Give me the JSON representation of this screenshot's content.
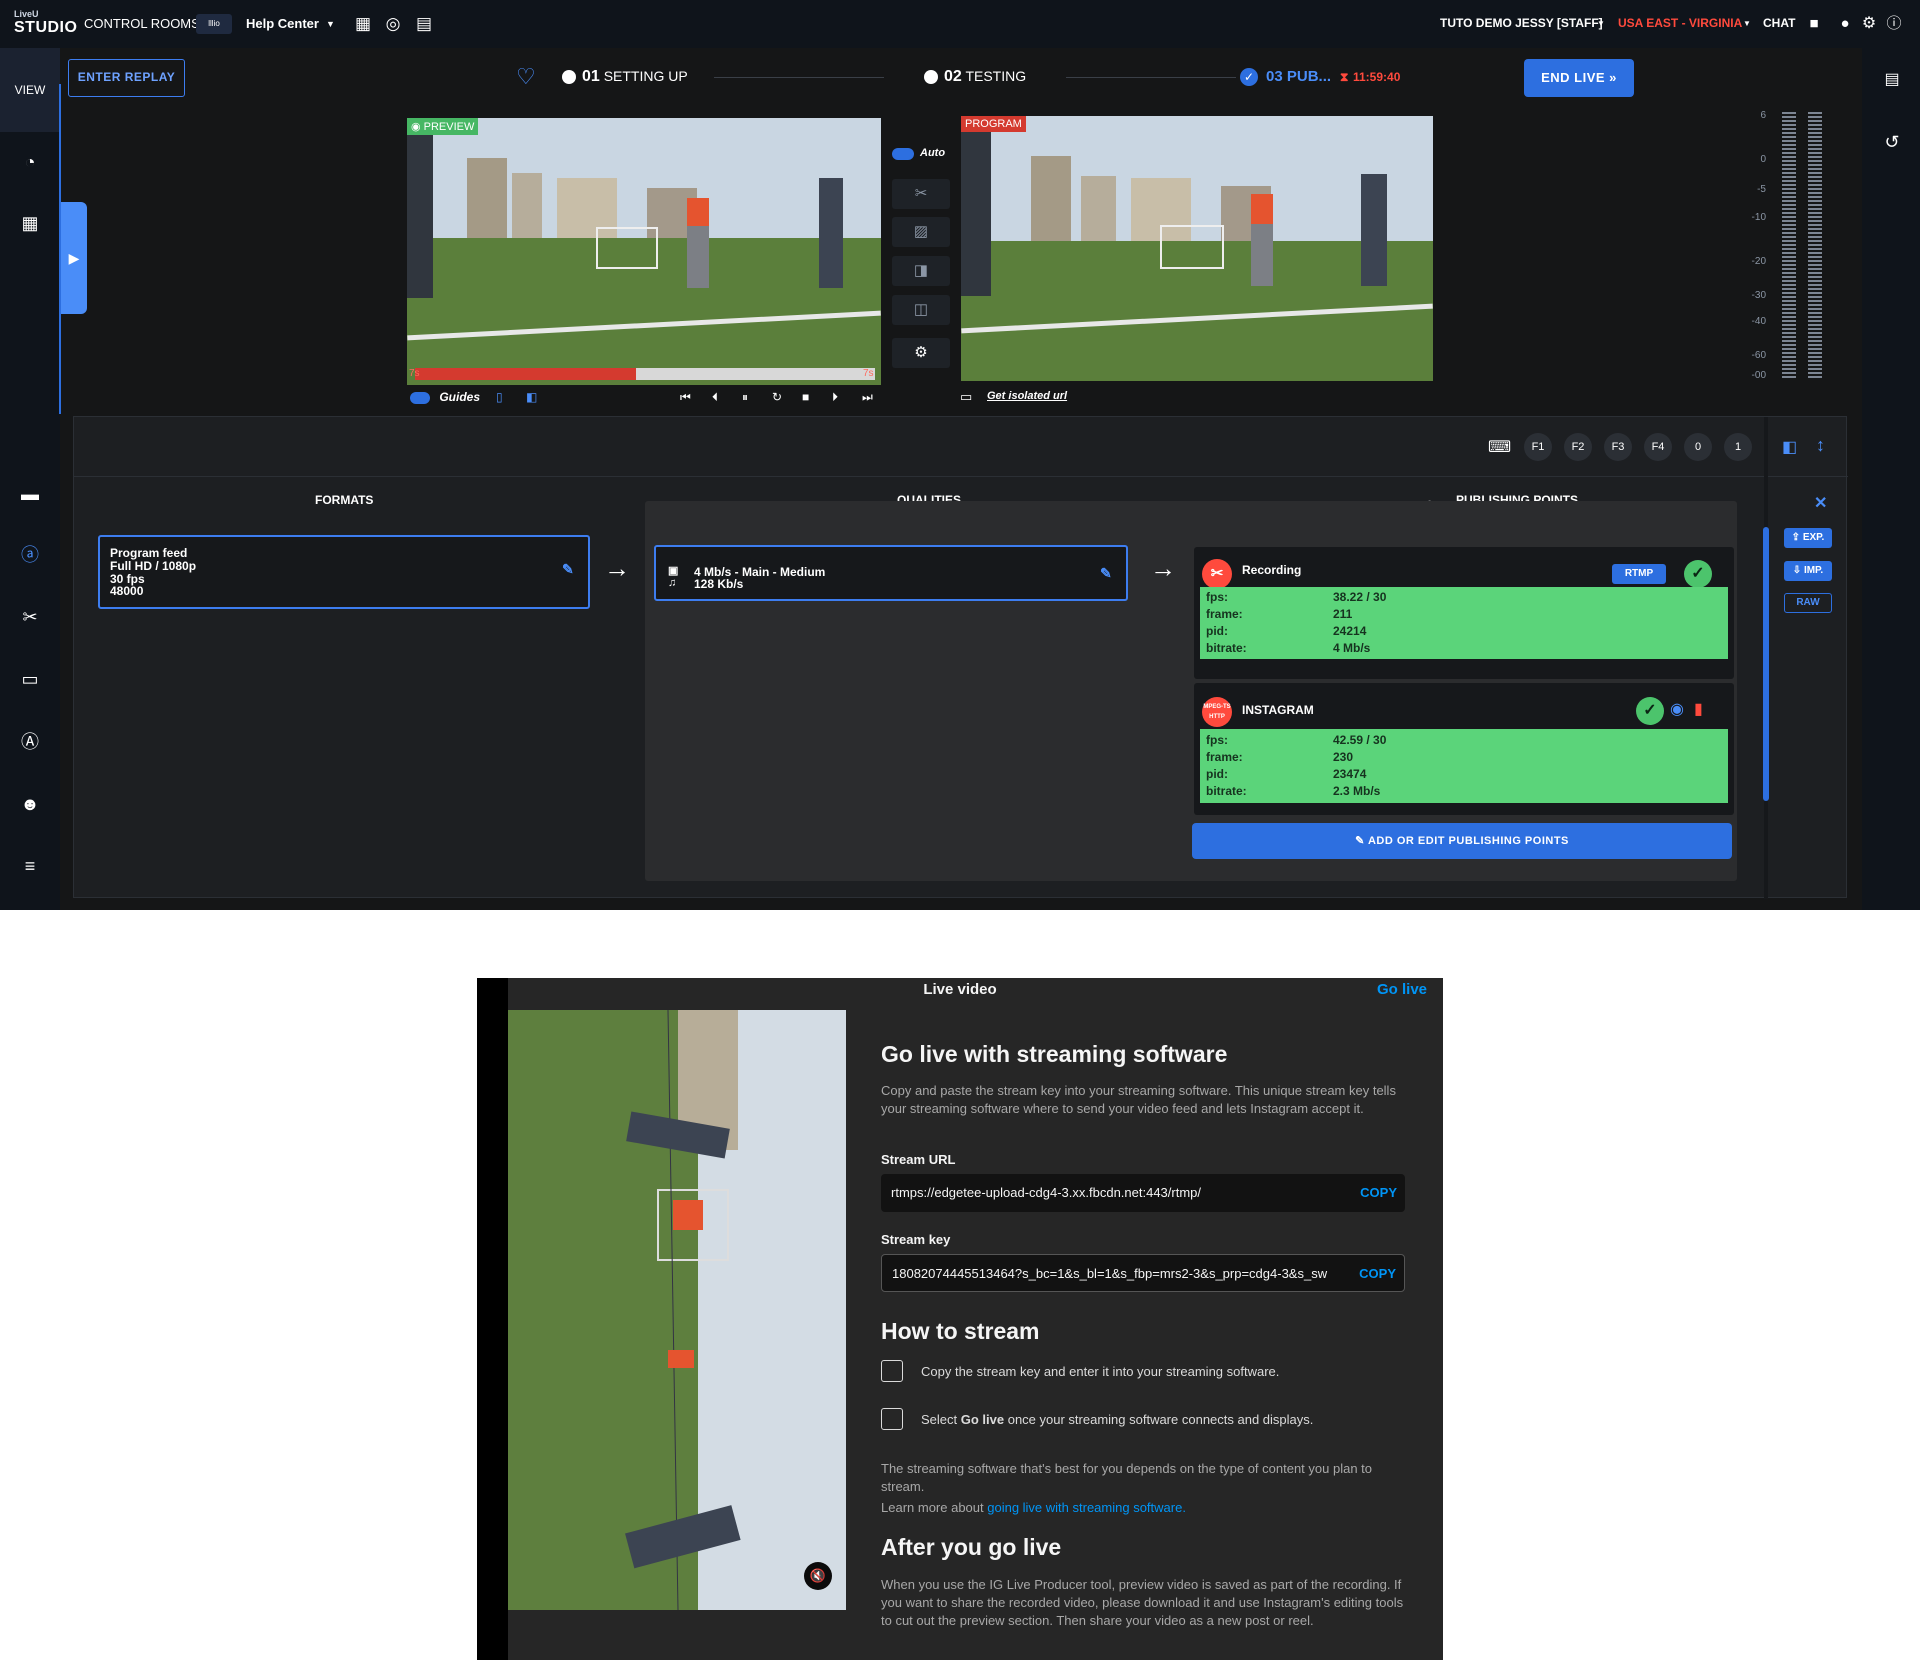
{
  "topbar": {
    "logo_small": "LiveU",
    "logo_big": "STUDIO",
    "control_rooms": "CONTROL ROOMS",
    "badge": "lllio",
    "help_center": "Help Center",
    "user": "TUTO DEMO JESSY [STAFF]",
    "region": "USA EAST - VIRGINIA",
    "chat": "CHAT"
  },
  "sidebar": {
    "view": "VIEW"
  },
  "toolbar": {
    "enter_replay": "ENTER REPLAY",
    "step1_num": "01",
    "step1_label": "SETTING UP",
    "step2_num": "02",
    "step2_label": "TESTING",
    "step3_label": "03 PUB...",
    "timer": "11:59:40",
    "end_live": "END LIVE"
  },
  "preview": {
    "label": "PREVIEW",
    "start_time": "7s",
    "end_time": "7s",
    "progress": 0.48,
    "guides": "Guides"
  },
  "program": {
    "label": "PROGRAM",
    "isolated_url": "Get isolated url"
  },
  "transitions": {
    "auto": "Auto"
  },
  "meter": {
    "labels": [
      "6",
      "0",
      "-5",
      "-10",
      "-20",
      "-30",
      "-40",
      "-60",
      "-00"
    ]
  },
  "panel": {
    "fkeys": [
      "F1",
      "F2",
      "F3",
      "F4",
      "0",
      "1"
    ],
    "formats_head": "FORMATS",
    "qualities_head": "QUALITIES",
    "publishing_head": "PUBLISHING POINTS",
    "format_card": {
      "line1": "Program feed",
      "line2": "Full HD / 1080p",
      "line3": "30 fps",
      "line4": "48000"
    },
    "quality_card": {
      "video": "4 Mb/s  -  Main  -  Medium",
      "audio": "128 Kb/s"
    },
    "publishing_points": [
      {
        "name": "Recording",
        "tag": "RTMP",
        "stats": [
          {
            "k": "fps:",
            "v": "38.22 / 30"
          },
          {
            "k": "frame:",
            "v": "211"
          },
          {
            "k": "pid:",
            "v": "24214"
          },
          {
            "k": "bitrate:",
            "v": "4 Mb/s"
          }
        ]
      },
      {
        "name": "INSTAGRAM",
        "icon_text": "MPEG-TS HTTP",
        "stats": [
          {
            "k": "fps:",
            "v": "42.59 / 30"
          },
          {
            "k": "frame:",
            "v": "230"
          },
          {
            "k": "pid:",
            "v": "23474"
          },
          {
            "k": "bitrate:",
            "v": "2.3 Mb/s"
          }
        ]
      }
    ],
    "add_edit": "ADD OR EDIT PUBLISHING POINTS",
    "exp": "EXP.",
    "imp": "IMP.",
    "raw": "RAW"
  },
  "modal": {
    "title": "Live video",
    "go_live": "Go live",
    "h1": "Go live with streaming software",
    "intro": "Copy and paste the stream key into your streaming software. This unique stream key tells your streaming software where to send your video feed and lets Instagram accept it.",
    "stream_url_label": "Stream URL",
    "stream_url": "rtmps://edgetee-upload-cdg4-3.xx.fbcdn.net:443/rtmp/",
    "stream_key_label": "Stream key",
    "stream_key": "18082074445513464?s_bc=1&s_bl=1&s_fbp=mrs2-3&s_prp=cdg4-3&s_sw",
    "copy": "COPY",
    "h2": "How to stream",
    "step1": "Copy the stream key and enter it into your streaming software.",
    "step2_pre": "Select ",
    "step2_bold": "Go live",
    "step2_post": " once your streaming software connects and displays.",
    "note": "The streaming software that's best for you depends on the type of content you plan to stream.",
    "learn_pre": "Learn more about ",
    "learn_link": "going live with streaming software.",
    "h3": "After you go live",
    "after": "When you use the IG Live Producer tool, preview video is saved as part of the recording. If you want to share the recorded video, please download it and use Instagram's editing tools to cut out the preview section. Then share your video as a new post or reel."
  },
  "colors": {
    "accent": "#2d6fe0",
    "ok": "#5bd47a",
    "alert": "#ff4a3d",
    "ig_link": "#0095f6"
  }
}
